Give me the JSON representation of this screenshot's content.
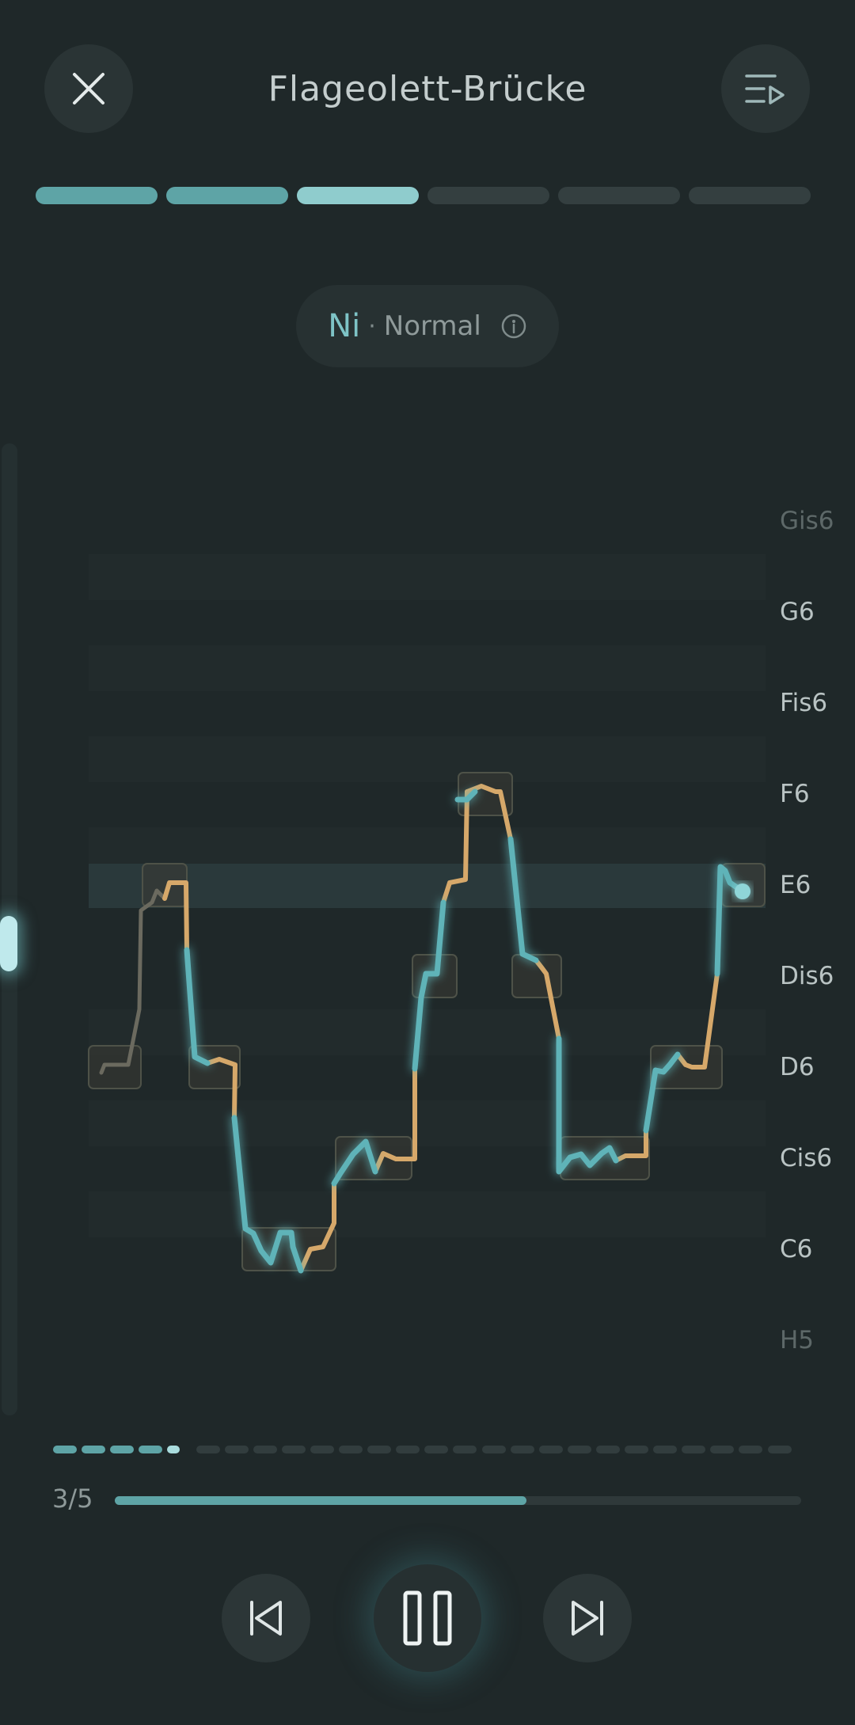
{
  "header": {
    "title": "Flageolett-Brücke",
    "close_icon": "close-icon",
    "playlist_icon": "playlist-play-icon"
  },
  "stage_progress": {
    "total": 6,
    "completed": 3,
    "current_index": 3,
    "colors": {
      "done": "#5ea4a6",
      "current": "#8fcccd",
      "pending": "#343f40"
    }
  },
  "mode": {
    "ni": "Ni",
    "separator": "·",
    "difficulty": "Normal",
    "info_icon": "info-icon"
  },
  "pitch_chart": {
    "notes": [
      "Gis6",
      "G6",
      "Fis6",
      "F6",
      "E6",
      "Dis6",
      "D6",
      "Cis6",
      "C6",
      "H5"
    ],
    "faded_notes": [
      "Gis6",
      "H5"
    ],
    "target_note": "E6",
    "colors": {
      "pitch_line_teal": "#5fb3b8",
      "pitch_line_gold": "#d6a86a"
    }
  },
  "exercise_dots": {
    "total": 26,
    "completed": 4,
    "current": 5
  },
  "playback": {
    "counter": "3/5",
    "progress_fraction": 0.6
  },
  "controls": {
    "previous_icon": "skip-previous-icon",
    "pause_icon": "pause-icon",
    "next_icon": "skip-next-icon"
  }
}
